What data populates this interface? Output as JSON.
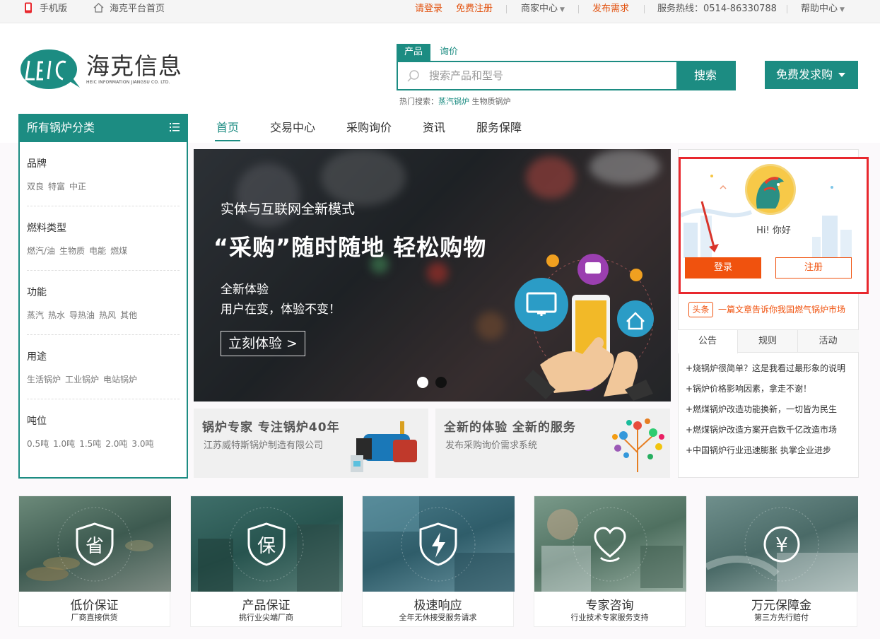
{
  "topbar": {
    "mobile": "手机版",
    "home": "海克平台首页",
    "login": "请登录",
    "register": "免费注册",
    "merchant": "商家中心",
    "publish": "发布需求",
    "hotline": "服务热线：0514-86330788",
    "help": "帮助中心"
  },
  "logo": {
    "cn": "海克信息",
    "en": "HEIC INFORMATION JIANGSU CO. LTD."
  },
  "search": {
    "tabs": [
      "产品",
      "询价"
    ],
    "placeholder": "搜索产品和型号",
    "button": "搜索",
    "hot_label": "热门搜索：",
    "hot_terms": [
      "蒸汽锅炉",
      "生物质锅炉"
    ]
  },
  "post_button": "免费发求购",
  "categories": {
    "header": "所有锅炉分类",
    "groups": [
      {
        "title": "品牌",
        "links": [
          "双良",
          "特富",
          "中正"
        ]
      },
      {
        "title": "燃料类型",
        "links": [
          "燃汽/油",
          "生物质",
          "电能",
          "燃煤"
        ]
      },
      {
        "title": "功能",
        "links": [
          "蒸汽",
          "热水",
          "导热油",
          "热风",
          "其他"
        ]
      },
      {
        "title": "用途",
        "links": [
          "生活锅炉",
          "工业锅炉",
          "电站锅炉"
        ]
      },
      {
        "title": "吨位",
        "links": [
          "0.5吨",
          "1.0吨",
          "1.5吨",
          "2.0吨",
          "3.0吨"
        ]
      }
    ]
  },
  "nav": [
    "首页",
    "交易中心",
    "采购询价",
    "资讯",
    "服务保障"
  ],
  "banner": {
    "subtitle": "实体与互联网全新模式",
    "title": "“采购”随时随地 轻松购物",
    "line1": "全新体验",
    "line2": "用户在变，体验不变！",
    "cta": "立刻体验 >"
  },
  "sub_banners": [
    {
      "title": "锅炉专家 专注锅炉40年",
      "desc": "江苏威特斯锅炉制造有限公司"
    },
    {
      "title": "全新的体验 全新的服务",
      "desc": "发布采购询价需求系统"
    }
  ],
  "user": {
    "greeting": "Hi! 你好",
    "login": "登录",
    "register": "注册"
  },
  "headline": {
    "tag": "头条",
    "text": "一篇文章告诉你我国燃气锅炉市场"
  },
  "news": {
    "tabs": [
      "公告",
      "规则",
      "活动"
    ],
    "items": [
      "+烧锅炉很简单？这是我看过最形象的说明",
      "+锅炉价格影响因素，拿走不谢！",
      "+燃煤锅炉改造功能换新，一切皆为民生",
      "+燃煤锅炉改造方案开启数千亿改造市场",
      "+中国锅炉行业迅速膨胀 执掌企业进步"
    ]
  },
  "services": [
    {
      "title": "低价保证",
      "sub": "厂商直接供货",
      "icon": "省"
    },
    {
      "title": "产品保证",
      "sub": "挑行业尖端厂商",
      "icon": "保"
    },
    {
      "title": "极速响应",
      "sub": "全年无休接受服务请求",
      "icon": ""
    },
    {
      "title": "专家咨询",
      "sub": "行业技术专家服务支持",
      "icon": ""
    },
    {
      "title": "万元保障金",
      "sub": "第三方先行赔付",
      "icon": "¥"
    }
  ],
  "colors": {
    "brand": "#1c8c82",
    "accent": "#f0520e",
    "highlight": "#e8282e"
  }
}
